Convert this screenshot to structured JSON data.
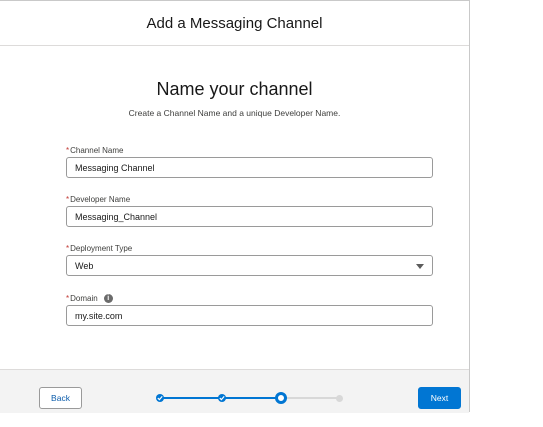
{
  "modal": {
    "title": "Add a Messaging Channel",
    "heading": "Name your channel",
    "subheading": "Create a Channel Name and a unique Developer Name."
  },
  "fields": {
    "channel_name": {
      "label": "Channel Name",
      "required_mark": "*",
      "value": "Messaging Channel"
    },
    "developer_name": {
      "label": "Developer Name",
      "required_mark": "*",
      "value": "Messaging_Channel"
    },
    "deployment_type": {
      "label": "Deployment Type",
      "required_mark": "*",
      "value": "Web"
    },
    "domain": {
      "label": "Domain",
      "required_mark": "*",
      "info_icon": "i",
      "value": "my.site.com"
    }
  },
  "footer": {
    "back_label": "Back",
    "next_label": "Next",
    "progress": {
      "total_steps": 4,
      "completed_steps": 2,
      "current_step": 3
    }
  },
  "colors": {
    "brand": "#0176d3",
    "required": "#c23934"
  },
  "icons": {
    "dropdown": "chevron-down-icon",
    "info": "info-icon",
    "completed_step": "check-icon"
  }
}
